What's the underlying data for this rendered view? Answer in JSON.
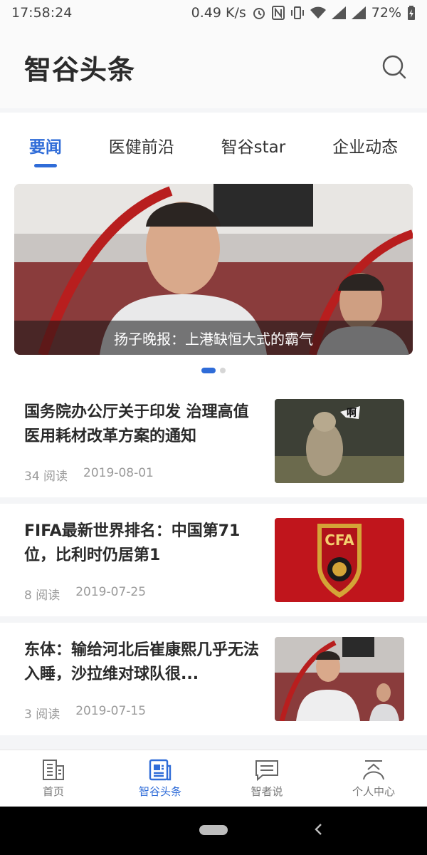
{
  "status": {
    "time": "17:58:24",
    "speed": "0.49 K/s",
    "battery": "72%"
  },
  "header": {
    "title": "智谷头条",
    "search_icon": "search-icon"
  },
  "tabs": [
    {
      "label": "要闻",
      "active": true
    },
    {
      "label": "医健前沿",
      "active": false
    },
    {
      "label": "智谷star",
      "active": false
    },
    {
      "label": "企业动态",
      "active": false
    }
  ],
  "banner": {
    "caption": "扬子晚报：上港缺恒大式的霸气"
  },
  "news": [
    {
      "title": "国务院办公厅关于印发 治理高值医用耗材改革方案的通知",
      "reads": "34 阅读",
      "date": "2019-08-01",
      "thumb_label": "啊"
    },
    {
      "title": "FIFA最新世界排名：中国第71位，比利时仍居第1",
      "reads": "8 阅读",
      "date": "2019-07-25",
      "thumb_label": "CFA"
    },
    {
      "title": "东体：输给河北后崔康熙几乎无法入睡，沙拉维对球队很...",
      "reads": "3 阅读",
      "date": "2019-07-15"
    }
  ],
  "tabbar": [
    {
      "label": "首页",
      "icon": "building-icon",
      "active": false
    },
    {
      "label": "智谷头条",
      "icon": "newspaper-icon",
      "active": true
    },
    {
      "label": "智者说",
      "icon": "chat-icon",
      "active": false
    },
    {
      "label": "个人中心",
      "icon": "person-icon",
      "active": false
    }
  ],
  "colors": {
    "accent": "#2f6cd8",
    "text_primary": "#2a2a2a",
    "text_secondary": "#9a9a9a"
  }
}
